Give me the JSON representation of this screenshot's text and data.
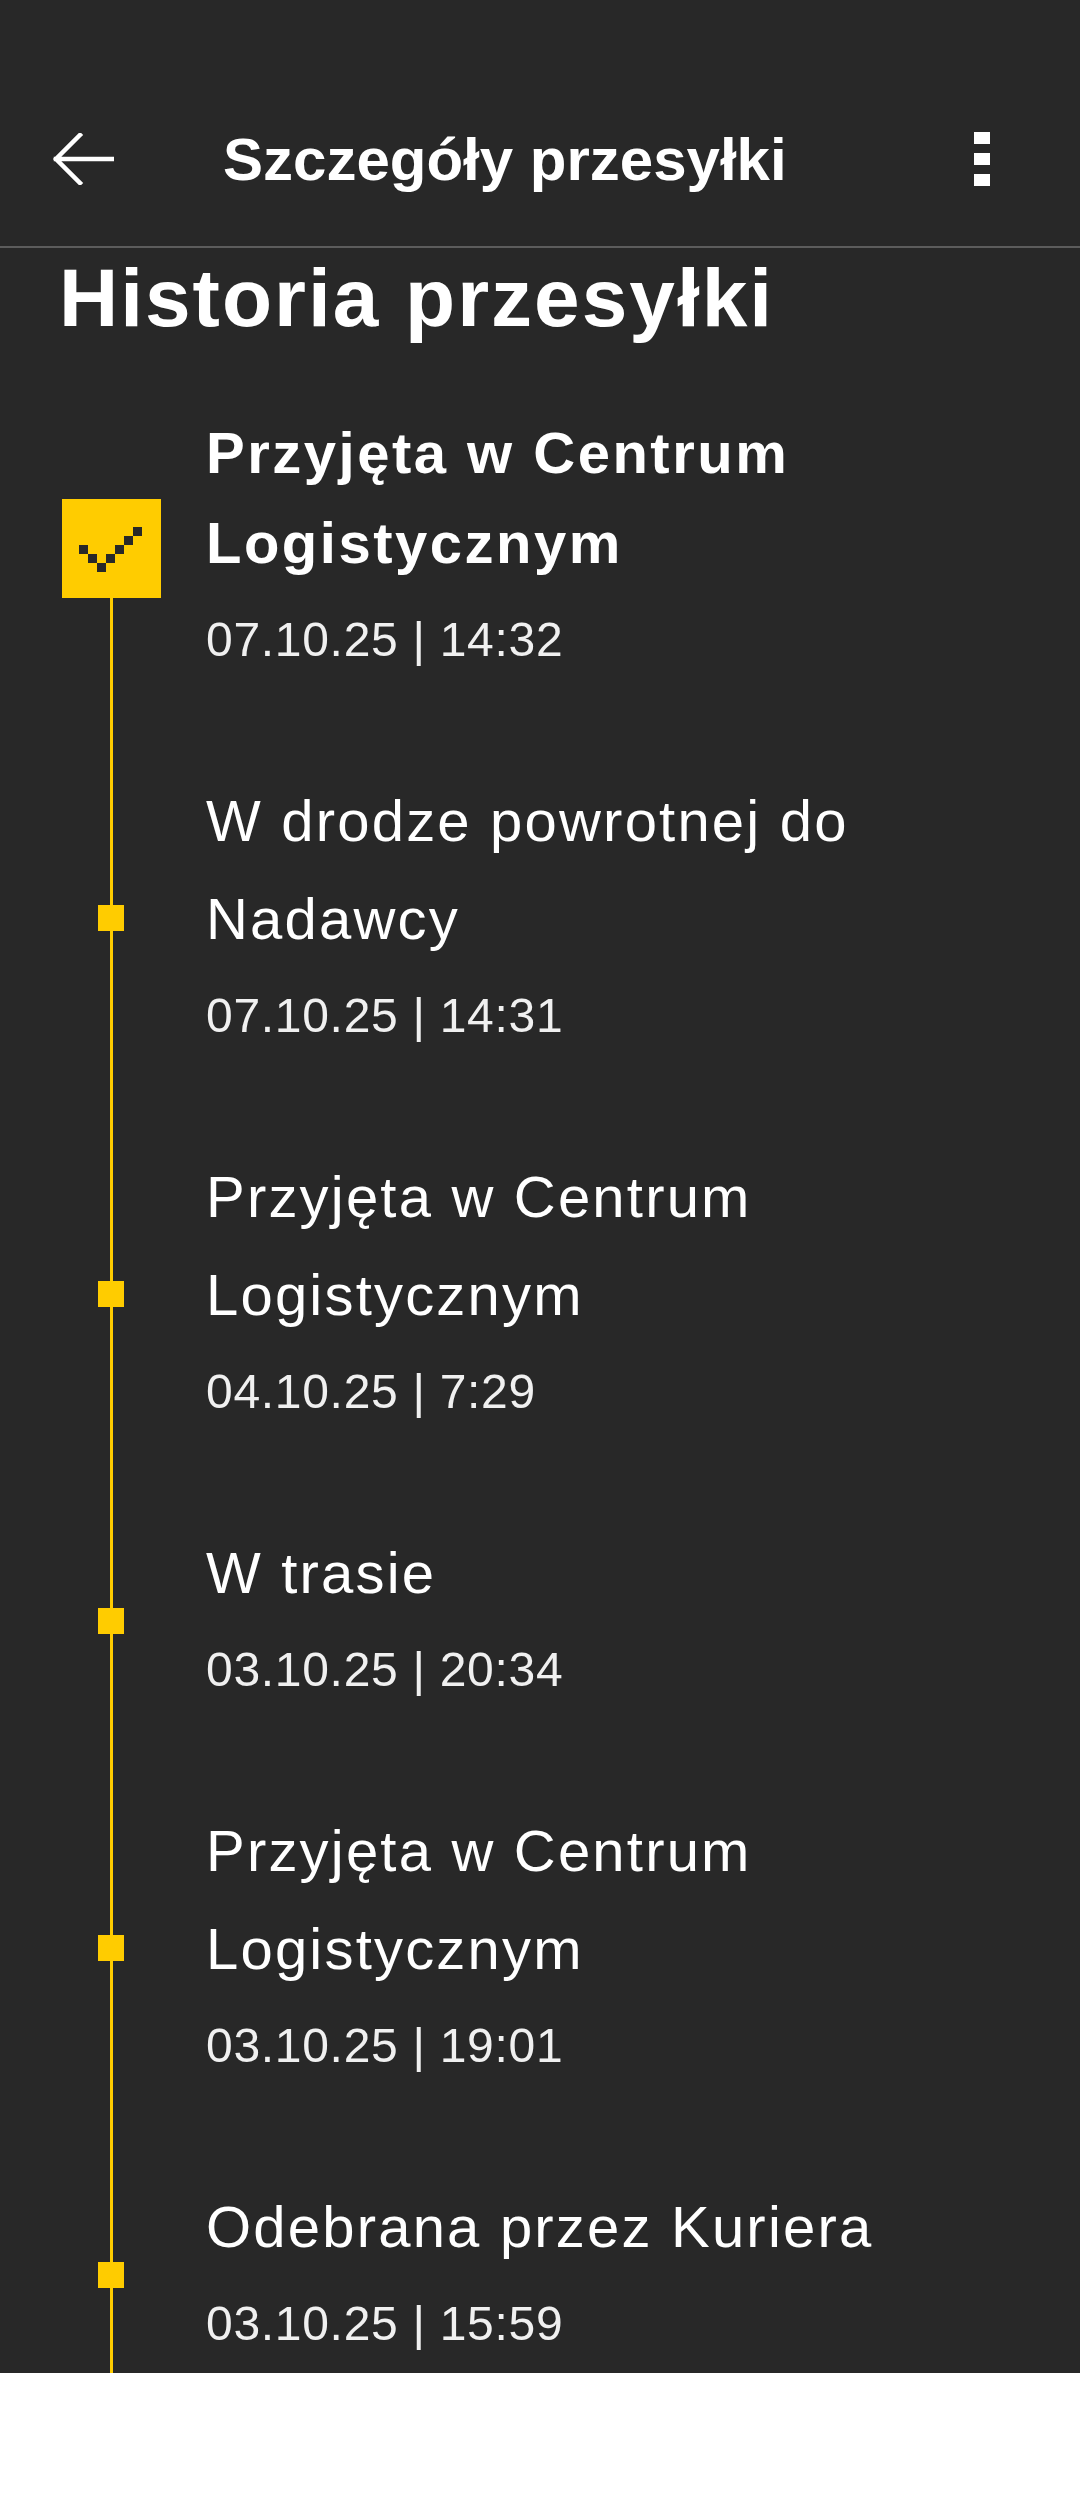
{
  "header": {
    "title": "Szczegóły przesyłki"
  },
  "section_title": "Historia przesyłki",
  "events": [
    {
      "title": "Przyjęta w Centrum Logistycznym",
      "date": "07.10.25 | 14:32",
      "current": true
    },
    {
      "title": "W drodze powrotnej do Nadawcy",
      "date": "07.10.25 | 14:31",
      "current": false
    },
    {
      "title": "Przyjęta w Centrum Logistycznym",
      "date": "04.10.25 | 7:29",
      "current": false
    },
    {
      "title": "W trasie",
      "date": "03.10.25 | 20:34",
      "current": false
    },
    {
      "title": "Przyjęta w Centrum Logistycznym",
      "date": "03.10.25 | 19:01",
      "current": false
    },
    {
      "title": "Odebrana przez Kuriera",
      "date": "03.10.25 | 15:59",
      "current": false
    }
  ]
}
